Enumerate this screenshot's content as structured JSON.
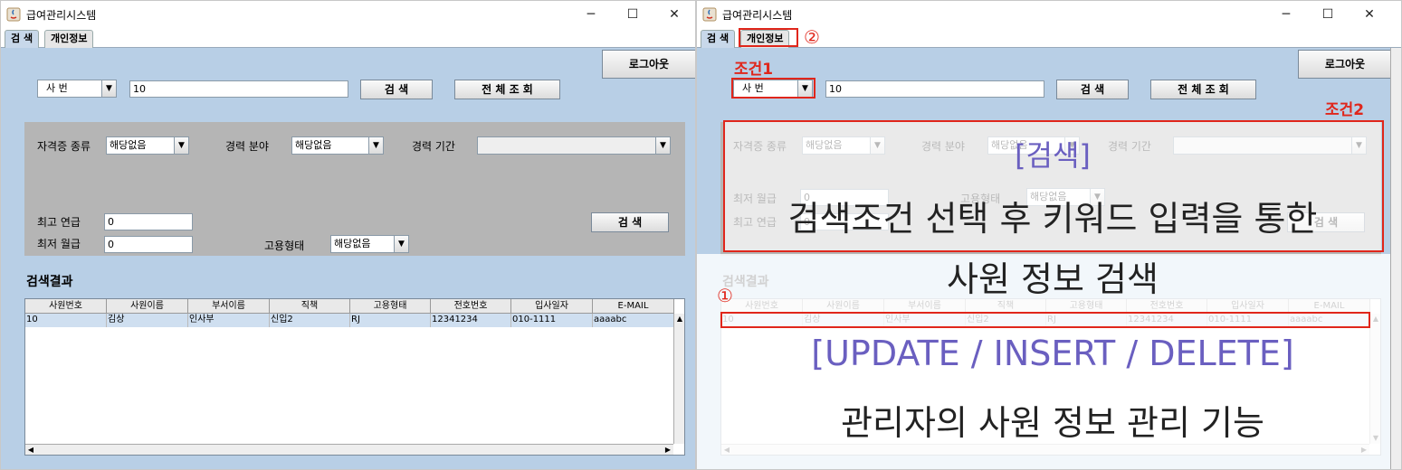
{
  "app": {
    "title": "급여관리시스템",
    "min": "─",
    "max": "☐",
    "close": "✕"
  },
  "tabs": {
    "search": "검 색",
    "personal": "개인정보"
  },
  "toolbar": {
    "logout": "로그아웃",
    "search_type": "사 번",
    "keyword": "10",
    "search": "검 색",
    "view_all": "전 체 조 회"
  },
  "filters": {
    "cert_label": "자격증 종류",
    "cert_value": "해당없음",
    "career_field_label": "경력 분야",
    "career_field_value": "해당없음",
    "career_period_label": "경력 기간",
    "career_period_value": "",
    "min_salary_label": "최저 월급",
    "min_salary_value": "0",
    "max_salary_label": "최고 연급",
    "max_salary_value": "0",
    "employment_label": "고용형태",
    "employment_value": "해당없음",
    "search": "검 색"
  },
  "results": {
    "title": "검색결과",
    "columns": [
      "사원번호",
      "사원이름",
      "부서이름",
      "직책",
      "고용형태",
      "전호번호",
      "입사일자",
      "E-MAIL"
    ],
    "rows": [
      [
        "10",
        "김상",
        "인사부",
        "신입2",
        "RJ",
        "12341234",
        "010-1111",
        "aaaabc"
      ]
    ]
  },
  "annotations": {
    "marker1": "①",
    "marker2": "②",
    "cond1": "조건1",
    "cond2": "조건2",
    "line1": "[검색]",
    "line2": "검색조건 선택 후 키워드 입력을 통한",
    "line3": "사원 정보 검색",
    "line4": "[UPDATE / INSERT / DELETE]",
    "line5": "관리자의 사원 정보 관리 기능"
  },
  "colors": {
    "background": "#b8cfe6",
    "panel": "#b5b5b5",
    "annotation_red": "#e0261b",
    "annotation_purple": "#6a5fc0"
  },
  "icons": {
    "dropdown": "▼",
    "scroll_up": "▲",
    "scroll_down": "▼",
    "scroll_left": "◀",
    "scroll_right": "▶"
  }
}
